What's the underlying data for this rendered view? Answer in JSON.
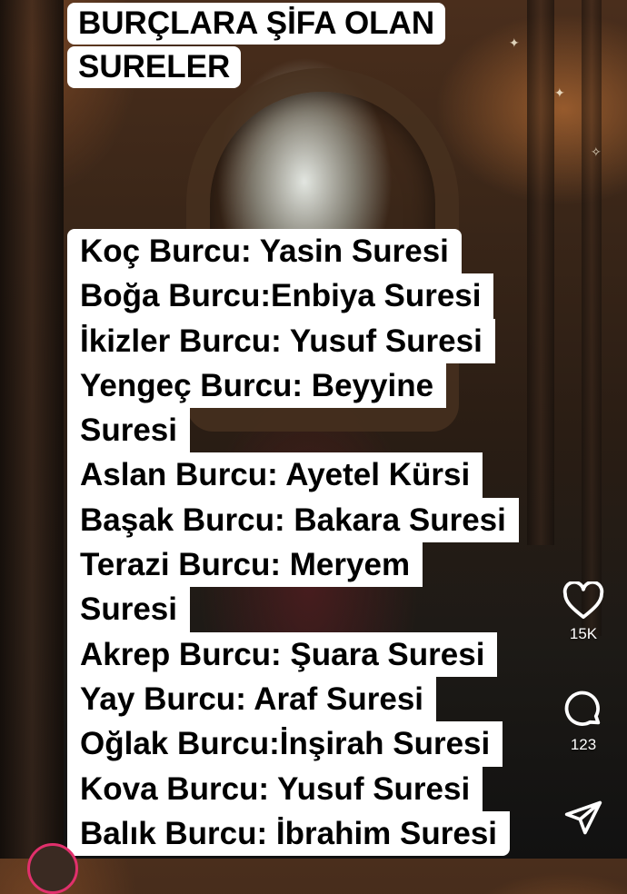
{
  "post": {
    "title_lines": [
      "BURÇLARA ŞİFA OLAN",
      "SURELER"
    ],
    "list_lines": [
      "Koç Burcu: Yasin Suresi",
      "Boğa Burcu:Enbiya Suresi",
      "İkizler Burcu: Yusuf Suresi",
      "Yengeç Burcu: Beyyine",
      "Suresi",
      "Aslan Burcu: Ayetel Kürsi",
      "Başak Burcu: Bakara Suresi",
      "Terazi Burcu: Meryem",
      "Suresi",
      "Akrep Burcu: Şuara Suresi",
      "Yay Burcu: Araf Suresi",
      "Oğlak Burcu:İnşirah Suresi",
      "Kova Burcu: Yusuf Suresi",
      "Balık Burcu: İbrahim Suresi"
    ]
  },
  "actions": {
    "like": {
      "icon": "heart-icon",
      "count": "15K"
    },
    "comment": {
      "icon": "comment-icon",
      "count": "123"
    },
    "share": {
      "icon": "send-icon",
      "count": ""
    }
  },
  "colors": {
    "caption_bg": "#ffffff",
    "caption_text": "#000000",
    "avatar_ring": "#e1306c"
  }
}
